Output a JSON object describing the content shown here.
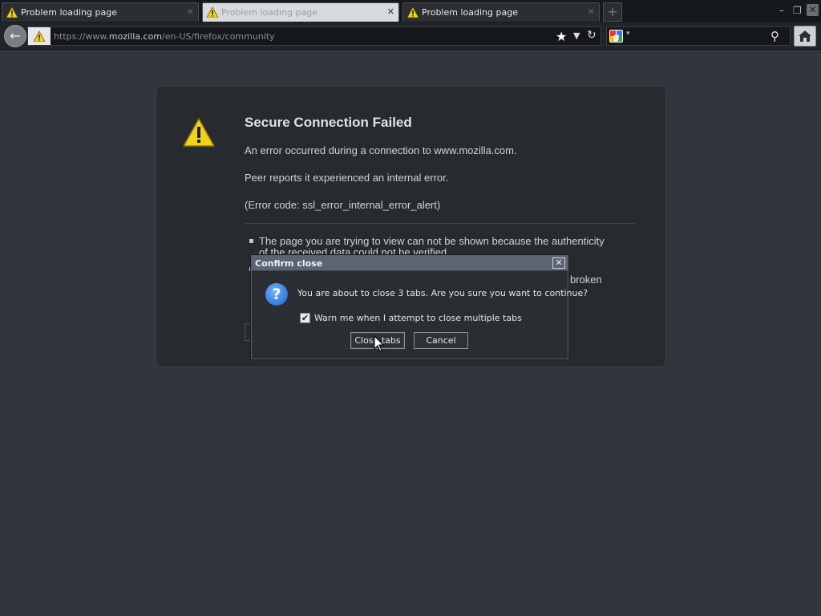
{
  "colors": {
    "page_background": "#31363d",
    "warning_yellow": "#f2d31c",
    "dialog_titlebar": "#5b6470",
    "question_icon_blue": "#1c63c9"
  },
  "tabs": [
    {
      "label": "Problem loading page",
      "icon": "warning-icon",
      "selected": false
    },
    {
      "label": "Problem loading page",
      "icon": "warning-icon",
      "selected": true
    },
    {
      "label": "Problem loading page",
      "icon": "warning-icon",
      "selected": false
    }
  ],
  "urlbar": {
    "prefix": "https://www.",
    "host": "mozilla.com",
    "path": "/en-US/firefox/community"
  },
  "error_page": {
    "title": "Secure Connection Failed",
    "line1": "An error occurred during a connection to www.mozilla.com.",
    "line2": "Peer reports it experienced an internal error.",
    "line3": "(Error code: ssl_error_internal_error_alert)",
    "bullet1_line1": "The page you are trying to view can not be shown because the authenticity",
    "bullet1_line2": "of the received data could not be verified.",
    "bullet2_fragment": "broken"
  },
  "dialog": {
    "title": "Confirm close",
    "message": "You are about to close 3 tabs. Are you sure you want to continue?",
    "checkbox_label": "Warn me when I attempt to close multiple tabs",
    "checkbox_checked": true,
    "close_tabs_label": "Close tabs",
    "cancel_label": "Cancel"
  }
}
